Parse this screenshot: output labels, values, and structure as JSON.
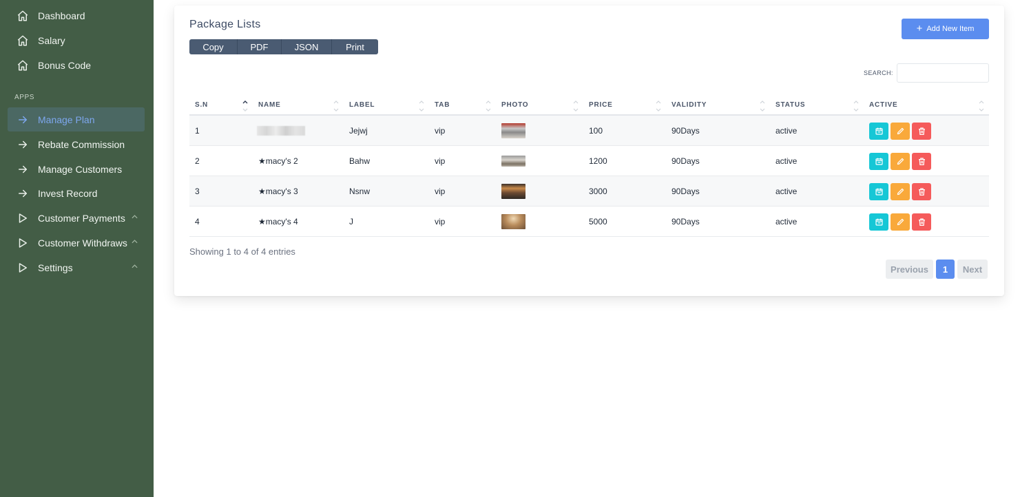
{
  "sidebar": {
    "items": [
      {
        "label": "Dashboard",
        "icon": "home-icon"
      },
      {
        "label": "Salary",
        "icon": "home-icon"
      },
      {
        "label": "Bonus Code",
        "icon": "home-icon"
      }
    ],
    "section_label": "APPS",
    "apps": [
      {
        "label": "Manage Plan",
        "icon": "arrow-right-icon",
        "active": true
      },
      {
        "label": "Rebate Commission",
        "icon": "arrow-right-icon"
      },
      {
        "label": "Manage Customers",
        "icon": "arrow-right-icon"
      },
      {
        "label": "Invest Record",
        "icon": "arrow-right-icon"
      },
      {
        "label": "Customer Payments",
        "icon": "play-icon",
        "expandable": true
      },
      {
        "label": "Customer Withdraws",
        "icon": "play-icon",
        "expandable": true
      },
      {
        "label": "Settings",
        "icon": "play-icon",
        "expandable": true
      }
    ]
  },
  "card": {
    "title": "Package Lists",
    "export_buttons": [
      "Copy",
      "PDF",
      "JSON",
      "Print"
    ],
    "add_button": "Add New Item",
    "search_label": "SEARCH:",
    "search_value": ""
  },
  "table": {
    "columns": [
      "S.N",
      "NAME",
      "LABEL",
      "TAB",
      "PHOTO",
      "PRICE",
      "VALIDITY",
      "STATUS",
      "ACTIVE"
    ],
    "rows": [
      {
        "sn": "1",
        "name": "",
        "label": "Jejwj",
        "tab": "vip",
        "price": "100",
        "validity": "90Days",
        "status": "active"
      },
      {
        "sn": "2",
        "name": "★macy's 2",
        "label": "Bahw",
        "tab": "vip",
        "price": "1200",
        "validity": "90Days",
        "status": "active"
      },
      {
        "sn": "3",
        "name": "★macy's 3",
        "label": "Nsnw",
        "tab": "vip",
        "price": "3000",
        "validity": "90Days",
        "status": "active"
      },
      {
        "sn": "4",
        "name": "★macy's 4",
        "label": "J",
        "tab": "vip",
        "price": "5000",
        "validity": "90Days",
        "status": "active"
      }
    ],
    "row_actions": [
      "calendar-icon",
      "pencil-icon",
      "trash-icon"
    ]
  },
  "footer": {
    "info": "Showing 1 to 4 of 4 entries",
    "prev": "Previous",
    "page": "1",
    "next": "Next"
  },
  "colors": {
    "sidebar_bg": "#435d46",
    "accent": "#5b8def",
    "action_cyan": "#16c7d6",
    "action_orange": "#f9a93b",
    "action_red": "#f55b5b"
  }
}
